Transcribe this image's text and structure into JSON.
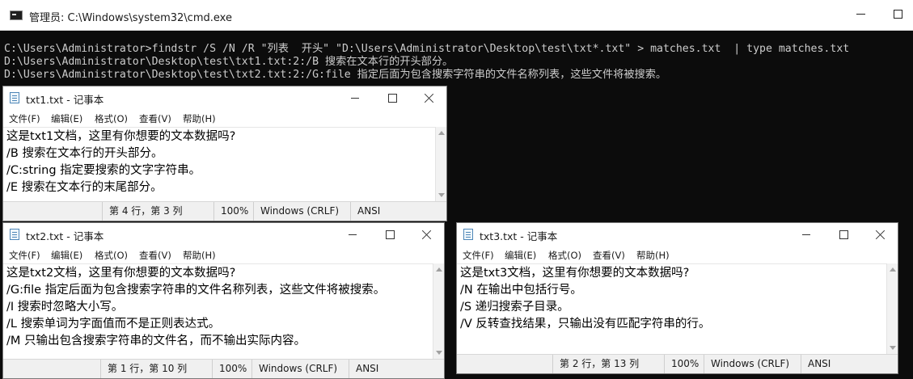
{
  "cmd": {
    "title": "管理员: C:\\Windows\\system32\\cmd.exe",
    "lines": [
      "C:\\Users\\Administrator>findstr /S /N /R \"列表  开头\" \"D:\\Users\\Administrator\\Desktop\\test\\txt*.txt\" > matches.txt  | type matches.txt",
      "D:\\Users\\Administrator\\Desktop\\test\\txt1.txt:2:/B 搜索在文本行的开头部分。",
      "D:\\Users\\Administrator\\Desktop\\test\\txt2.txt:2:/G:file 指定后面为包含搜索字符串的文件名称列表，这些文件将被搜索。"
    ]
  },
  "menus": [
    "文件(F)",
    "编辑(E)",
    "格式(O)",
    "查看(V)",
    "帮助(H)"
  ],
  "notepads": [
    {
      "title": "txt1.txt - 记事本",
      "lines": [
        "这是txt1文档，这里有你想要的文本数据吗?",
        "/B 搜索在文本行的开头部分。",
        "/C:string 指定要搜索的文字字符串。",
        "/E 搜索在文本行的末尾部分。"
      ],
      "status": {
        "position": "第 4 行，第 3 列",
        "zoom": "100%",
        "line_ending": "Windows (CRLF)",
        "encoding": "ANSI"
      }
    },
    {
      "title": "txt2.txt - 记事本",
      "lines": [
        "这是txt2文档，这里有你想要的文本数据吗?",
        "/G:file 指定后面为包含搜索字符串的文件名称列表，这些文件将被搜索。",
        "/I 搜索时忽略大小写。",
        "/L 搜索单词为字面值而不是正则表达式。",
        "/M 只输出包含搜索字符串的文件名，而不输出实际内容。"
      ],
      "status": {
        "position": "第 1 行，第 10 列",
        "zoom": "100%",
        "line_ending": "Windows (CRLF)",
        "encoding": "ANSI"
      }
    },
    {
      "title": "txt3.txt - 记事本",
      "lines": [
        "这是txt3文档，这里有你想要的文本数据吗?",
        "/N 在输出中包括行号。",
        "/S 递归搜索子目录。",
        "/V 反转查找结果，只输出没有匹配字符串的行。"
      ],
      "status": {
        "position": "第 2 行，第 13 列",
        "zoom": "100%",
        "line_ending": "Windows (CRLF)",
        "encoding": "ANSI"
      }
    }
  ]
}
